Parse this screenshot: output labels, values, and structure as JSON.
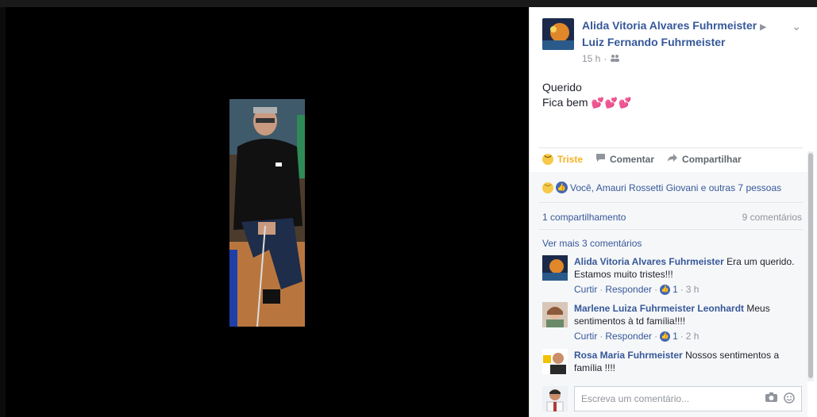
{
  "post": {
    "author": "Alida Vitoria Alvares Fuhrmeister",
    "recipient": "Luiz Fernando Fuhrmeister",
    "time": "15 h",
    "text_line1": "Querido",
    "text_line2": "Fica bem",
    "hearts": "💕💕💕"
  },
  "actions": {
    "triste": "Triste",
    "comentar": "Comentar",
    "compartilhar": "Compartilhar"
  },
  "reactions": {
    "summary": "Você, Amauri Rossetti Giovani e outras 7 pessoas"
  },
  "stats": {
    "shares": "1 compartilhamento",
    "comments": "9 comentários"
  },
  "comments_section": {
    "view_more": "Ver mais 3 comentários",
    "items": [
      {
        "name": "Alida Vitoria Alvares Fuhrmeister",
        "text": "Era um querido. Estamos muito tristes!!!",
        "like": "Curtir",
        "reply": "Responder",
        "likes": "1",
        "time": "3 h"
      },
      {
        "name": "Marlene Luiza Fuhrmeister Leonhardt",
        "text": "Meus sentimentos à td família!!!!",
        "like": "Curtir",
        "reply": "Responder",
        "likes": "1",
        "time": "2 h"
      },
      {
        "name": "Rosa Maria Fuhrmeister",
        "text": "Nossos sentimentos a família !!!!",
        "like": "Curtir",
        "reply": "Responder",
        "likes": "",
        "time": ""
      }
    ]
  },
  "composer": {
    "placeholder": "Escreva um comentário..."
  },
  "colors": {
    "link": "#365899",
    "triste": "#f7b125",
    "like_blue": "#4267b2"
  }
}
